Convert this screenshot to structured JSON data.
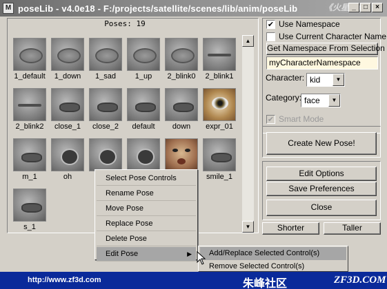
{
  "window": {
    "app_icon": "M",
    "title": "poseLib - v4.0e18 - F:/projects/satellite/scenes/lib/anim/poseLib",
    "watermark": "《火星时代》",
    "minimize": "_",
    "maximize": "□",
    "close": "×"
  },
  "poses": {
    "count_label": "Poses: 19",
    "items": [
      {
        "label": "1_default",
        "kind": "eye"
      },
      {
        "label": "1_down",
        "kind": "eye"
      },
      {
        "label": "1_sad",
        "kind": "eye"
      },
      {
        "label": "1_up",
        "kind": "eye"
      },
      {
        "label": "2_blink0",
        "kind": "eye"
      },
      {
        "label": "2_blink1",
        "kind": "closed"
      },
      {
        "label": "2_blink2",
        "kind": "closed"
      },
      {
        "label": "close_1",
        "kind": "mouth"
      },
      {
        "label": "close_2",
        "kind": "mouth"
      },
      {
        "label": "default",
        "kind": "mouth"
      },
      {
        "label": "down",
        "kind": "mouth"
      },
      {
        "label": "expr_01",
        "kind": "brown"
      },
      {
        "label": "m_1",
        "kind": "mouth"
      },
      {
        "label": "oh",
        "kind": "open"
      },
      {
        "label": "",
        "kind": "open"
      },
      {
        "label": "",
        "kind": "open"
      },
      {
        "label": "",
        "kind": "face"
      },
      {
        "label": "smile_1",
        "kind": "mouth"
      },
      {
        "label": "s_1",
        "kind": "mouth"
      }
    ],
    "scroll_up": "▲",
    "scroll_down": "▼"
  },
  "options": {
    "use_namespace": {
      "label": "Use Namespace",
      "checked": true,
      "mark": "✔"
    },
    "use_current_character_name": {
      "label": "Use Current Character Name",
      "checked": false,
      "mark": ""
    },
    "get_namespace_button": "Get Namespace From Selection",
    "namespace_value": "myCharacterNamespace",
    "character_label": "Character:",
    "character_value": "kid",
    "category_label": "Category:",
    "category_value": "face",
    "combo_arrow": "▼",
    "smart_mode": {
      "label": "Smart Mode",
      "checked": true,
      "disabled": true,
      "mark": "✔"
    },
    "create_new_pose_button": "Create New Pose!",
    "edit_options_button": "Edit Options",
    "save_preferences_button": "Save Preferences",
    "close_button": "Close",
    "shorter_button": "Shorter",
    "taller_button": "Taller"
  },
  "context_menu": {
    "items": [
      {
        "label": "Select Pose Controls"
      },
      {
        "label": "Rename Pose"
      },
      {
        "label": "Move Pose"
      },
      {
        "label": "Replace Pose"
      },
      {
        "label": "Delete Pose"
      },
      {
        "label": "Edit Pose",
        "submenu": true
      }
    ],
    "submenu_arrow": "▶",
    "submenu": [
      {
        "label": "Add/Replace Selected Control(s)",
        "active": true
      },
      {
        "label": "Remove Selected Control(s)",
        "active": false
      }
    ]
  },
  "footer": {
    "url": "http://www.zf3d.com",
    "site_name": "朱峰社区",
    "brand": "ZF3D.COM"
  },
  "colors": {
    "window_bg": "#d4d0c8",
    "title_bar": "#8c8c8c",
    "field_bg": "#fff8e0",
    "footer_bg": "#0a2a9a"
  }
}
